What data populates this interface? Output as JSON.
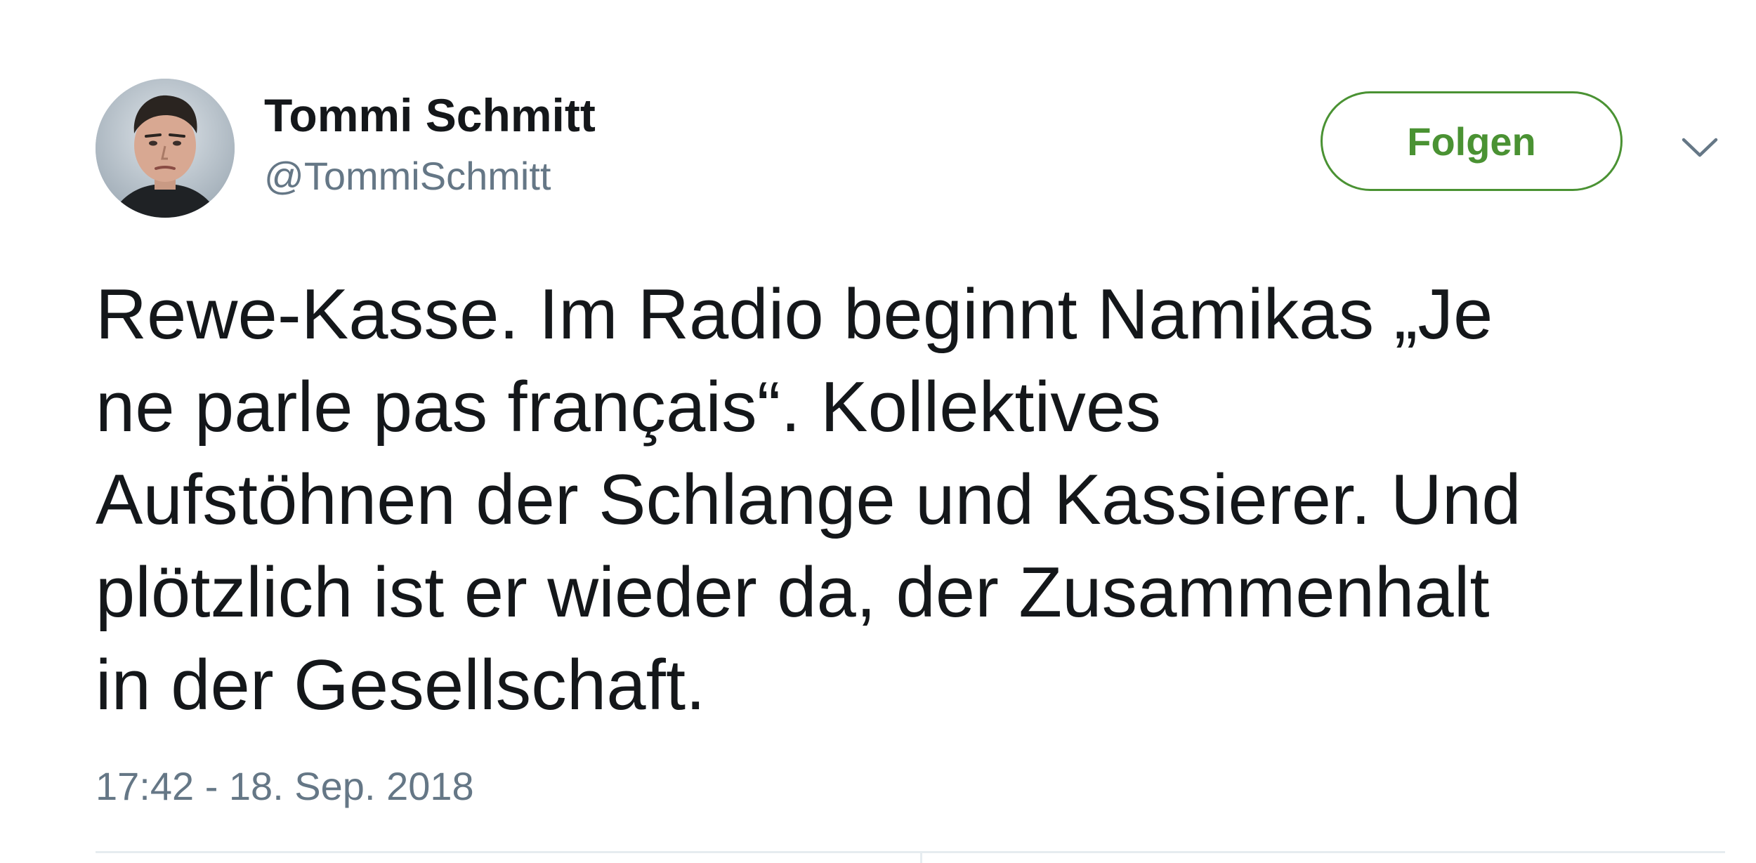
{
  "author": {
    "display_name": "Tommi Schmitt",
    "handle": "@TommiSchmitt"
  },
  "follow_button": {
    "label": "Folgen"
  },
  "more_menu": {
    "icon": "chevron-down-icon"
  },
  "tweet": {
    "lines": [
      "Rewe-Kasse. Im Radio beginnt Namikas „Je",
      "ne parle pas français“. Kollektives",
      "Aufstöhnen der Schlange und Kassierer. Und",
      "plötzlich ist er wieder da, der Zusammenhalt",
      "in der Gesellschaft."
    ],
    "timestamp": "17:42 - 18. Sep. 2018"
  },
  "colors": {
    "follow_accent": "#4a9233",
    "secondary_text": "#657786",
    "primary_text": "#14171a",
    "divider": "#e6ecf0"
  }
}
